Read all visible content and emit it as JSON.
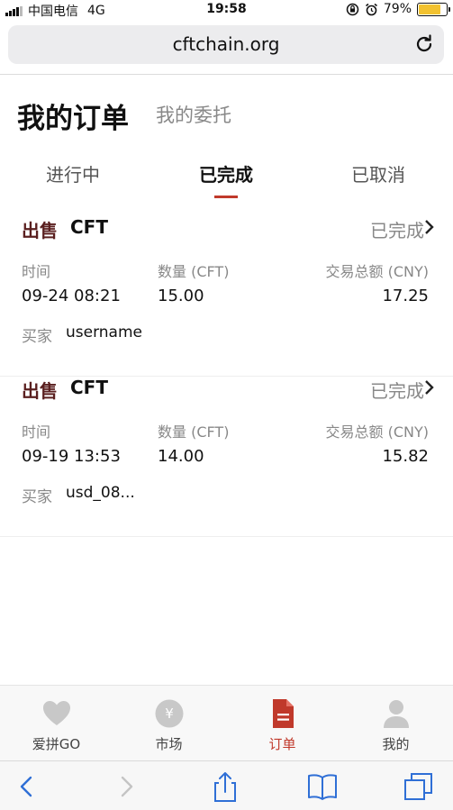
{
  "status_bar": {
    "carrier": "中国电信",
    "network": "4G",
    "time": "19:58",
    "battery": "79%",
    "battery_level": 0.79
  },
  "browser": {
    "url": "cftchain.org"
  },
  "header": {
    "title": "我的订单",
    "subtitle": "我的委托"
  },
  "tabs": [
    {
      "label": "进行中",
      "active": false
    },
    {
      "label": "已完成",
      "active": true
    },
    {
      "label": "已取消",
      "active": false
    }
  ],
  "columns": {
    "time": "时间",
    "quantity": "数量 (CFT)",
    "total": "交易总额 (CNY)",
    "buyer": "买家"
  },
  "orders": [
    {
      "type": "出售",
      "coin": "CFT",
      "status": "已完成",
      "time": "09-24 08:21",
      "quantity": "15.00",
      "total": "17.25",
      "buyer": "username"
    },
    {
      "type": "出售",
      "coin": "CFT",
      "status": "已完成",
      "time": "09-19 13:53",
      "quantity": "14.00",
      "total": "15.82",
      "buyer": "usd_08..."
    }
  ],
  "nav": [
    {
      "label": "爱拼GO",
      "icon": "heart-icon",
      "active": false
    },
    {
      "label": "市场",
      "icon": "yuan-icon",
      "active": false
    },
    {
      "label": "订单",
      "icon": "document-icon",
      "active": true
    },
    {
      "label": "我的",
      "icon": "person-icon",
      "active": false
    }
  ],
  "colors": {
    "accent": "#c0392b",
    "order_type": "#5a1f1f",
    "muted": "#888888",
    "battery": "#f2c230"
  }
}
